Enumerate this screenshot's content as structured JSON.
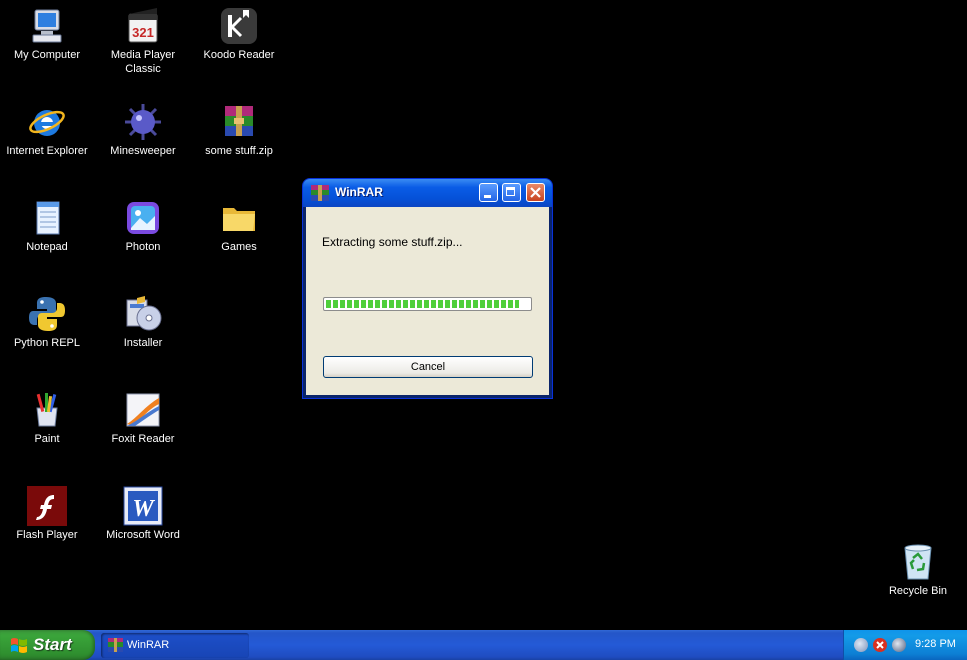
{
  "desktop": {
    "icons": [
      {
        "label": "My Computer",
        "icon": "my-computer-icon"
      },
      {
        "label": "Media Player Classic",
        "icon": "media-player-classic-icon"
      },
      {
        "label": "Koodo Reader",
        "icon": "koodo-reader-icon"
      },
      {
        "label": "Internet Explorer",
        "icon": "internet-explorer-icon"
      },
      {
        "label": "Minesweeper",
        "icon": "minesweeper-icon"
      },
      {
        "label": "some stuff.zip",
        "icon": "winrar-archive-icon"
      },
      {
        "label": "Notepad",
        "icon": "notepad-icon"
      },
      {
        "label": "Photon",
        "icon": "photon-icon"
      },
      {
        "label": "Games",
        "icon": "folder-icon"
      },
      {
        "label": "Python REPL",
        "icon": "python-icon"
      },
      {
        "label": "Installer",
        "icon": "installer-icon"
      },
      {
        "label": "Paint",
        "icon": "paint-icon"
      },
      {
        "label": "Foxit Reader",
        "icon": "foxit-reader-icon"
      },
      {
        "label": "Flash Player",
        "icon": "flash-player-icon"
      },
      {
        "label": "Microsoft Word",
        "icon": "microsoft-word-icon"
      },
      {
        "label": "Recycle Bin",
        "icon": "recycle-bin-icon"
      }
    ]
  },
  "window": {
    "title": "WinRAR",
    "message": "Extracting some stuff.zip...",
    "progress": 0.95,
    "cancel_label": "Cancel"
  },
  "taskbar": {
    "start_label": "Start",
    "task_label": "WinRAR",
    "clock": "9:28 PM"
  },
  "colors": {
    "desktop": "#000000",
    "titlebar": "#0551d8",
    "taskbar": "#245ad7",
    "start": "#3aa43a",
    "progress_fill": "#4fcf3a"
  }
}
